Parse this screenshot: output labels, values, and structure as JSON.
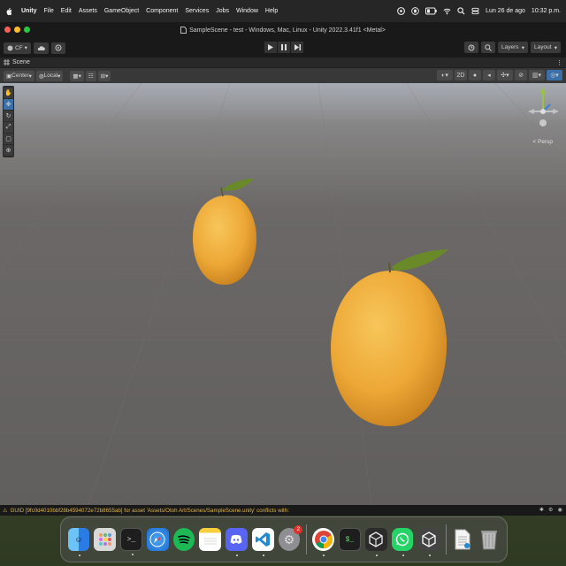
{
  "menubar": {
    "items": [
      "Unity",
      "File",
      "Edit",
      "Assets",
      "GameObject",
      "Component",
      "Services",
      "Jobs",
      "Window",
      "Help"
    ],
    "datetime": "Lun 26 de ago",
    "time": "10:32 p.m."
  },
  "window": {
    "title": "SampleScene - test - Windows, Mac, Linux - Unity 2022.3.41f1 <Metal>",
    "account_label": "CF",
    "layers_label": "Layers",
    "layout_label": "Layout"
  },
  "scene": {
    "tab_label": "Scene",
    "pivot_label": "Center",
    "space_label": "Local",
    "mode_2d": "2D",
    "persp_label": "< Persp"
  },
  "status": {
    "message": "GUID [9fc0d4010bbf28b4594072e72b8655ab] for asset 'Assets/Otoh Art/Scenes/SampleScene.unity' conflicts with:"
  },
  "dock": {
    "apps": [
      "finder",
      "launchpad",
      "terminal",
      "safari",
      "spotify",
      "notes",
      "discord",
      "vscode",
      "system-settings",
      "chrome",
      "terminal-2",
      "unity-hub",
      "whatsapp",
      "unity",
      "document",
      "trash"
    ],
    "settings_badge": "2"
  },
  "colors": {
    "accent": "#3b6fa8",
    "warning": "#e0b44a",
    "orange": "#f0a830",
    "leaf": "#6a8a2a"
  }
}
